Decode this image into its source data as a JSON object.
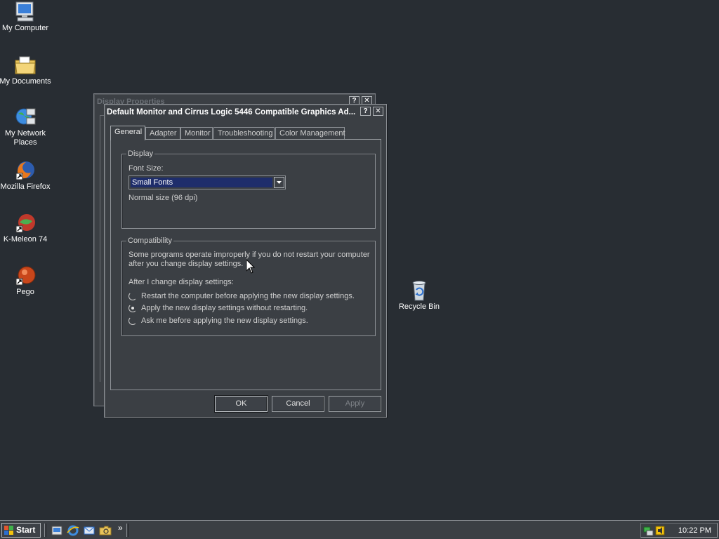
{
  "desktop": {
    "icons": [
      {
        "label": "My Computer",
        "icon": "computer-icon"
      },
      {
        "label": "My Documents",
        "icon": "folder-icon"
      },
      {
        "label": "My Network Places",
        "icon": "network-icon"
      },
      {
        "label": "Mozilla Firefox",
        "icon": "firefox-icon"
      },
      {
        "label": "K-Meleon 74",
        "icon": "kmeleon-icon"
      },
      {
        "label": "Pego",
        "icon": "pego-icon"
      },
      {
        "label": "Recycle Bin",
        "icon": "recycle-bin-icon"
      }
    ]
  },
  "back_window": {
    "title": "Display Properties",
    "help_label": "?",
    "close_label": "✕"
  },
  "dialog": {
    "title": "Default Monitor and Cirrus Logic 5446 Compatible Graphics Ad...",
    "help_label": "?",
    "close_label": "✕",
    "tabs": [
      {
        "label": "General",
        "active": true
      },
      {
        "label": "Adapter",
        "active": false
      },
      {
        "label": "Monitor",
        "active": false
      },
      {
        "label": "Troubleshooting",
        "active": false
      },
      {
        "label": "Color Management",
        "active": false
      }
    ],
    "display_group": {
      "legend": "Display",
      "font_size_label": "Font Size:",
      "font_size_value": "Small Fonts",
      "dpi_text": "Normal size (96 dpi)"
    },
    "compat_group": {
      "legend": "Compatibility",
      "desc_line1": "Some programs operate improperly if you do not restart your computer",
      "desc_line2": "after you change display settings.",
      "after_label": "After I change display settings:",
      "options": [
        {
          "label": "Restart the computer before applying the new display settings.",
          "checked": false
        },
        {
          "label": "Apply the new display settings without restarting.",
          "checked": true
        },
        {
          "label": "Ask me before applying the new display settings.",
          "checked": false
        }
      ]
    },
    "buttons": {
      "ok": "OK",
      "cancel": "Cancel",
      "apply": "Apply"
    }
  },
  "taskbar": {
    "start_label": "Start",
    "overflow_label": "»",
    "clock": "10:22 PM"
  },
  "colors": {
    "desktop": "#282d33",
    "window": "#3b3f44",
    "selection": "#1e2d6b"
  }
}
